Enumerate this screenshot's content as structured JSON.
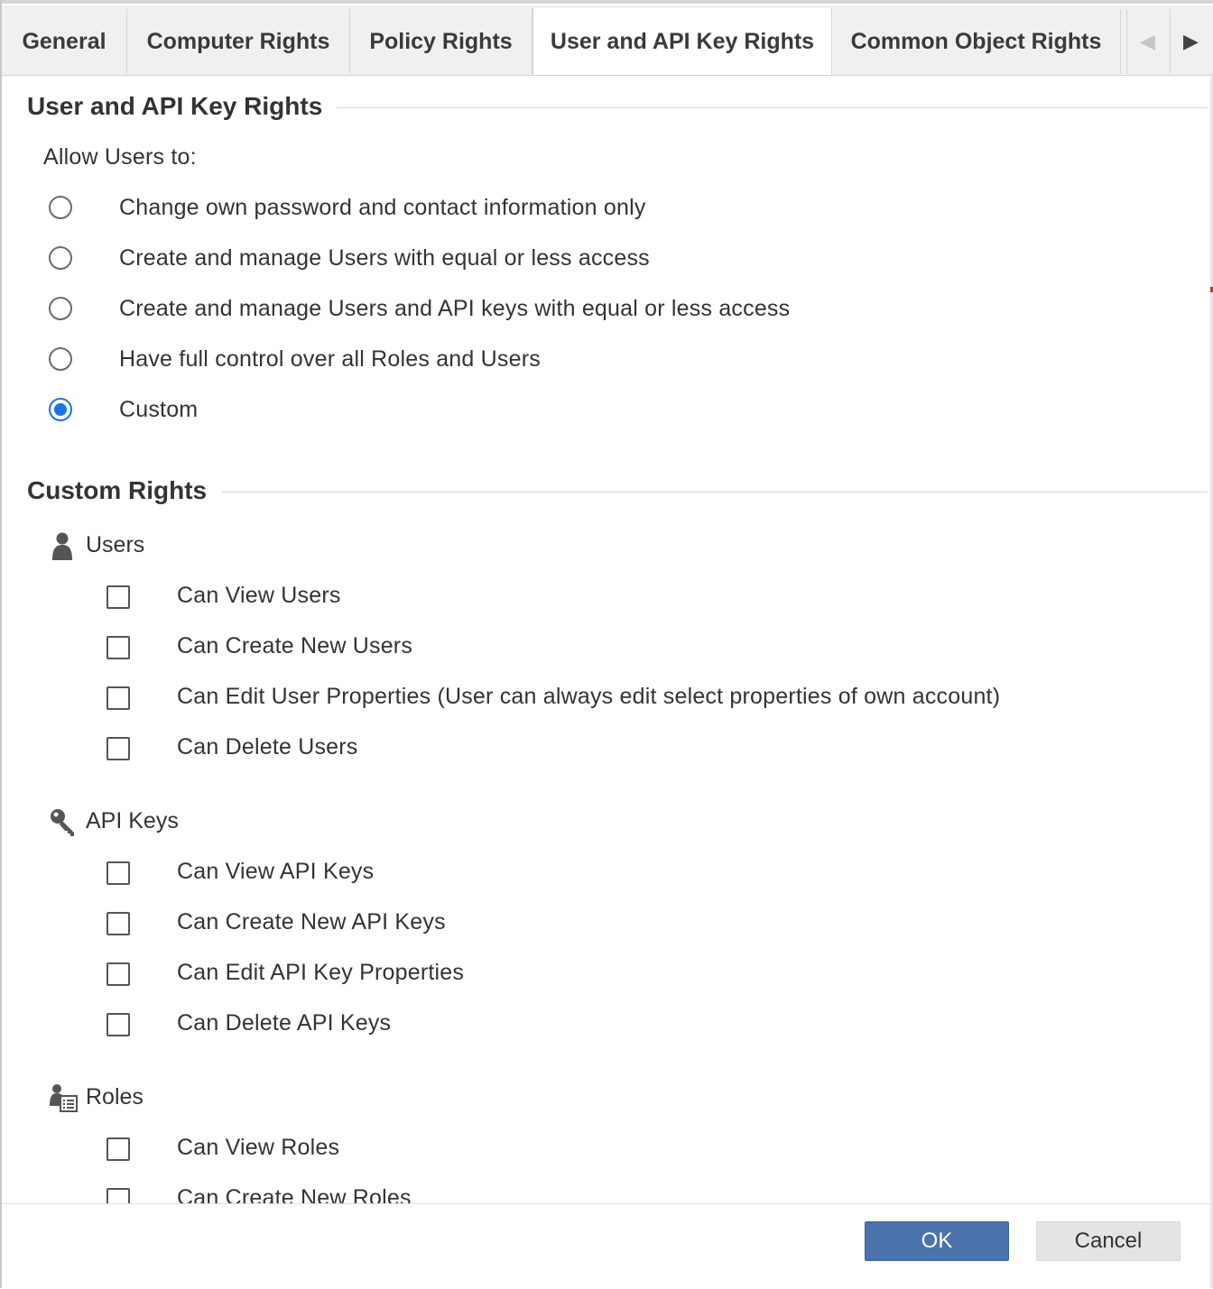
{
  "tabs": [
    {
      "label": "General",
      "active": false
    },
    {
      "label": "Computer Rights",
      "active": false
    },
    {
      "label": "Policy Rights",
      "active": false
    },
    {
      "label": "User and API Key Rights",
      "active": true
    },
    {
      "label": "Common Object Rights",
      "active": false
    }
  ],
  "section_user_rights": {
    "title": "User and API Key Rights",
    "allow_label": "Allow Users to:",
    "options": [
      {
        "label": "Change own password and contact information only",
        "selected": false
      },
      {
        "label": "Create and manage Users with equal or less access",
        "selected": false
      },
      {
        "label": "Create and manage Users and API keys with equal or less access",
        "selected": false
      },
      {
        "label": "Have full control over all Roles and Users",
        "selected": false
      },
      {
        "label": "Custom",
        "selected": true
      }
    ]
  },
  "section_custom": {
    "title": "Custom Rights",
    "groups": [
      {
        "label": "Users",
        "icon": "user-icon",
        "items": [
          {
            "label": "Can View Users",
            "checked": false
          },
          {
            "label": "Can Create New Users",
            "checked": false
          },
          {
            "label": "Can Edit User Properties (User can always edit select properties of own account)",
            "checked": false
          },
          {
            "label": "Can Delete Users",
            "checked": false
          }
        ]
      },
      {
        "label": "API Keys",
        "icon": "key-icon",
        "items": [
          {
            "label": "Can View API Keys",
            "checked": false
          },
          {
            "label": "Can Create New API Keys",
            "checked": false
          },
          {
            "label": "Can Edit API Key Properties",
            "checked": false
          },
          {
            "label": "Can Delete API Keys",
            "checked": false
          }
        ]
      },
      {
        "label": "Roles",
        "icon": "roles-icon",
        "items": [
          {
            "label": "Can View Roles",
            "checked": false
          },
          {
            "label": "Can Create New Roles",
            "checked": false
          }
        ]
      }
    ]
  },
  "footer": {
    "ok_label": "OK",
    "cancel_label": "Cancel"
  },
  "colors": {
    "accent": "#1a73e8",
    "primary_button": "#4a72ab"
  }
}
